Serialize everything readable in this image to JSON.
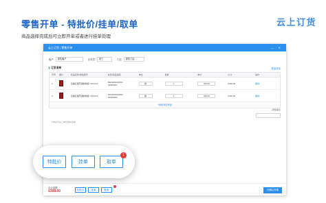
{
  "headline": "零售开单 - 特批价/挂单/取单",
  "subline": "商品选择完成后可立即开单或者进行挂单处理",
  "logo": "云上订货",
  "window": {
    "title": "云上订货 | 零售开单",
    "controls": "— ✕",
    "form": {
      "customer_label": "客户",
      "customer_value": "零售客户",
      "salesperson_label": "业务员",
      "salesperson_value": "张三",
      "shop_label": "门店",
      "shop_value": "零售门店"
    },
    "list": {
      "title": "订货清单",
      "link": "批量添加",
      "columns": [
        "序号",
        "图片",
        "商品名称/规格型号",
        "条码/商品编码",
        "单位",
        "数量",
        "单价",
        "小计",
        "操作"
      ],
      "rows": [
        {
          "index": "1",
          "name": "双鹿红葡萄酒整箱装 750ml×6",
          "code": "6920201000001",
          "sub_code": "SP000001",
          "unit": "箱",
          "qty": "1",
          "price": "199.00",
          "subtotal": "¥199.00",
          "action": "删除"
        },
        {
          "index": "2",
          "name": "双鹿红葡萄酒整箱装 750ml×6",
          "code": "6920201000002",
          "sub_code": "SP000002",
          "unit": "箱",
          "qty": "1",
          "price": "199.00",
          "subtotal": "¥199.00",
          "action": "删除"
        }
      ],
      "add_row": "+继续添加商品"
    },
    "side_tag": "+添加备注",
    "note": "下单后可在订单管理中查看",
    "footer": {
      "label": "合计金额",
      "amount": "¥398.00",
      "btn_special": "特批价",
      "btn_hold": "挂单",
      "btn_take": "取单",
      "submit": "已确认开单"
    }
  },
  "zoom": {
    "btn_special": "特批价",
    "btn_hold": "挂单",
    "btn_take": "取单",
    "badge": "1"
  }
}
